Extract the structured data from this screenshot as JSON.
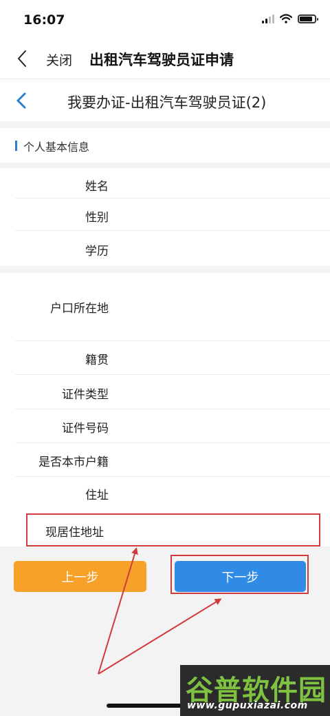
{
  "status_bar": {
    "time": "16:07"
  },
  "nav_bar": {
    "close_label": "关闭",
    "title": "出租汽车驾驶员证申请"
  },
  "page_header": {
    "title": "我要办证-出租汽车驾驶员证(2)"
  },
  "section": {
    "title": "个人基本信息"
  },
  "fields": {
    "name": "姓名",
    "gender": "性别",
    "education": "学历",
    "hukou_location": "户口所在地",
    "native_place": "籍贯",
    "id_type": "证件类型",
    "id_number": "证件号码",
    "local_hukou": "是否本市户籍",
    "address": "住址",
    "current_address": "现居住地址"
  },
  "buttons": {
    "prev_label": "上一步",
    "next_label": "下一步"
  },
  "watermark": {
    "main": "谷普软件园",
    "sub": "www.gupuxiazai.com"
  },
  "colors": {
    "accent_blue": "#2f8be6",
    "accent_orange": "#f7a129",
    "annotation_red": "#d13a3a",
    "watermark_green": "#7fc242"
  }
}
